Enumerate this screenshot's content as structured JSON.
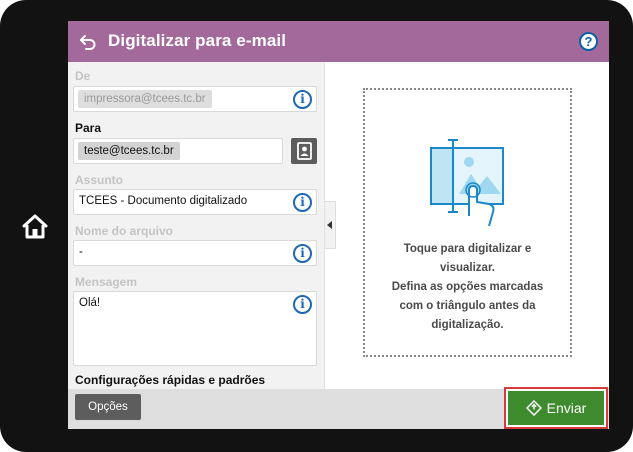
{
  "header": {
    "title": "Digitalizar para e-mail",
    "help_label": "?"
  },
  "form": {
    "from": {
      "label": "De",
      "value": "impressora@tcees.tc.br"
    },
    "to": {
      "label": "Para",
      "value": "teste@tcees.tc.br"
    },
    "subject": {
      "label": "Assunto",
      "value": "TCEES - Documento digitalizado"
    },
    "filename": {
      "label": "Nome do arquivo",
      "value": "-"
    },
    "message": {
      "label": "Mensagem",
      "value": "Olá!"
    },
    "quick_settings_title": "Configurações rápidas e padrões",
    "info_glyph": "i"
  },
  "preview": {
    "lines": [
      "Toque para digitalizar e",
      "visualizar.",
      "Defina as opções marcadas",
      "com o triângulo antes da",
      "digitalização."
    ]
  },
  "footer": {
    "options_label": "Opções",
    "send_label": "Enviar"
  },
  "colors": {
    "header": "#a3699a",
    "accent_yellow": "#f0c419",
    "send_green": "#3d8b2c",
    "send_highlight": "#d83b3b",
    "info_blue": "#1f66b5"
  },
  "icons": [
    "home-icon",
    "back-icon",
    "help-icon",
    "info-icon",
    "contact-book-icon",
    "collapse-arrow-icon",
    "scan-preview-icon",
    "send-diamond-icon"
  ]
}
